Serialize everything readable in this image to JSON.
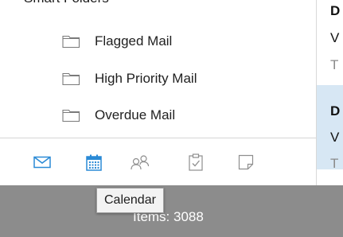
{
  "sidebar": {
    "group_header": "Smart Folders",
    "items": [
      {
        "label": "Flagged Mail",
        "icon": "folder-icon"
      },
      {
        "label": "High Priority Mail",
        "icon": "folder-icon"
      },
      {
        "label": "Overdue Mail",
        "icon": "folder-icon"
      }
    ]
  },
  "message_list": {
    "messages": [
      {
        "sender": "D",
        "subject": "V",
        "preview": "T",
        "selected": false
      },
      {
        "sender": "D",
        "subject": "V",
        "preview": "T",
        "selected": true
      }
    ]
  },
  "module_bar": {
    "modules": [
      {
        "name": "Mail",
        "icon": "mail-icon",
        "active": true
      },
      {
        "name": "Calendar",
        "icon": "calendar-icon",
        "active": true
      },
      {
        "name": "Contacts",
        "icon": "contacts-icon",
        "active": false
      },
      {
        "name": "Tasks",
        "icon": "tasks-icon",
        "active": false
      },
      {
        "name": "Notes",
        "icon": "notes-icon",
        "active": false
      }
    ]
  },
  "status": {
    "items_text": "Items: 3088"
  },
  "tooltip": {
    "text": "Calendar"
  },
  "colors": {
    "accent": "#2a8ad6",
    "inactive_icon": "#8e8e8e",
    "selected_row": "#d7e7f4",
    "status_bar": "#8c8c8c"
  }
}
